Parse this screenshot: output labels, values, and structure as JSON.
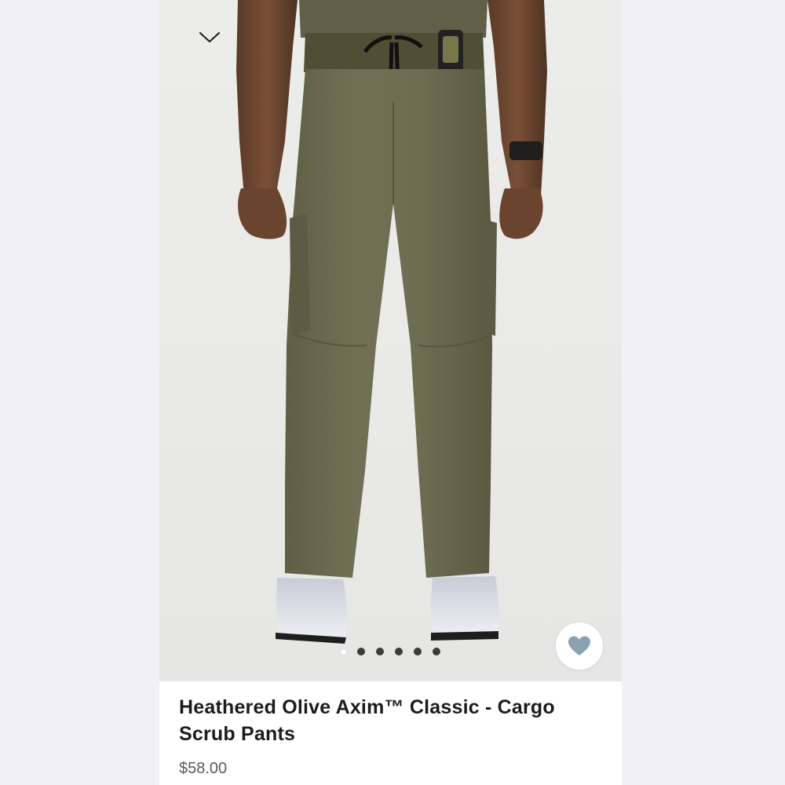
{
  "product": {
    "title": "Heathered Olive Axim™ Classic - Cargo Scrub Pants",
    "price": "$58.00"
  },
  "gallery": {
    "image_count": 6,
    "active_index": 0
  },
  "icons": {
    "collapse": "chevron-down-icon",
    "favorite": "heart-icon"
  },
  "colors": {
    "background": "#f1f1f3",
    "card": "#ffffff",
    "heart": "#8aa1b1",
    "pants": "#6b6b4f",
    "title_text": "#1c1c1c",
    "price_text": "#5a5a5a"
  }
}
